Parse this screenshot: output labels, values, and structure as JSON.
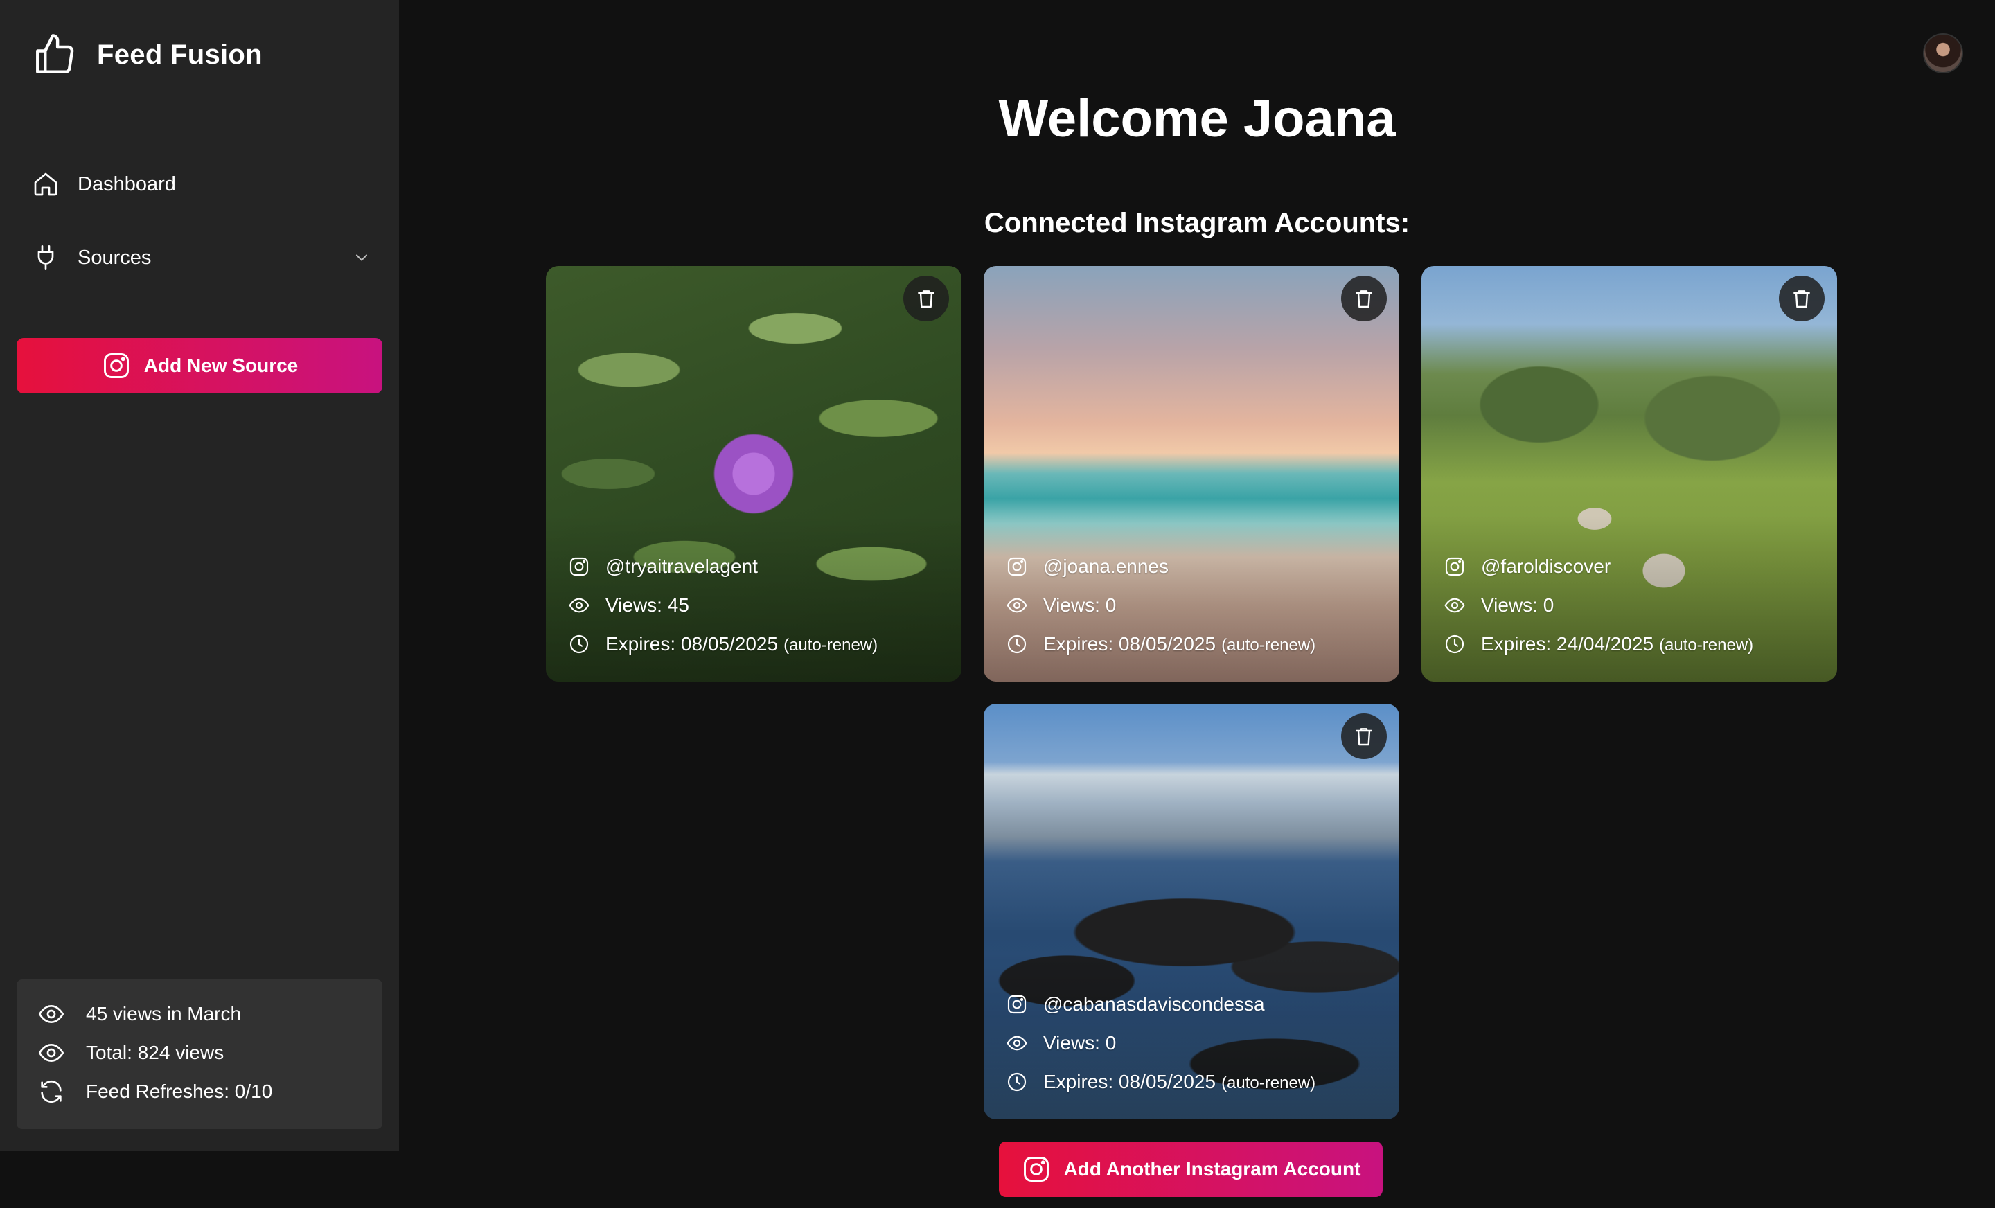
{
  "app": {
    "name": "Feed Fusion",
    "logo_icon": "thumbs-up-icon"
  },
  "sidebar": {
    "nav": [
      {
        "label": "Dashboard",
        "icon": "home-icon"
      },
      {
        "label": "Sources",
        "icon": "plug-icon",
        "expandable": true
      }
    ],
    "add_source_label": "Add New Source",
    "stats": [
      {
        "icon": "eye-icon",
        "text": "45 views in March"
      },
      {
        "icon": "eye-icon",
        "text": "Total: 824 views"
      },
      {
        "icon": "refresh-icon",
        "text": "Feed Refreshes: 0/10"
      }
    ]
  },
  "header": {
    "avatar": "user-avatar"
  },
  "main": {
    "welcome": "Welcome Joana",
    "subheading": "Connected Instagram Accounts:",
    "accounts": [
      {
        "handle": "@tryaitravelagent",
        "views": "Views: 45",
        "expires": "Expires: 08/05/2025",
        "renew": "(auto-renew)"
      },
      {
        "handle": "@joana.ennes",
        "views": "Views: 0",
        "expires": "Expires: 08/05/2025",
        "renew": "(auto-renew)"
      },
      {
        "handle": "@faroldiscover",
        "views": "Views: 0",
        "expires": "Expires: 24/04/2025",
        "renew": "(auto-renew)"
      },
      {
        "handle": "@cabanasdaviscondessa",
        "views": "Views: 0",
        "expires": "Expires: 08/05/2025",
        "renew": "(auto-renew)"
      }
    ],
    "add_account_label": "Add Another Instagram Account"
  },
  "colors": {
    "sidebar_bg": "#242424",
    "page_bg": "#111111",
    "accent_start": "#e6113c",
    "accent_end": "#c8127f"
  }
}
